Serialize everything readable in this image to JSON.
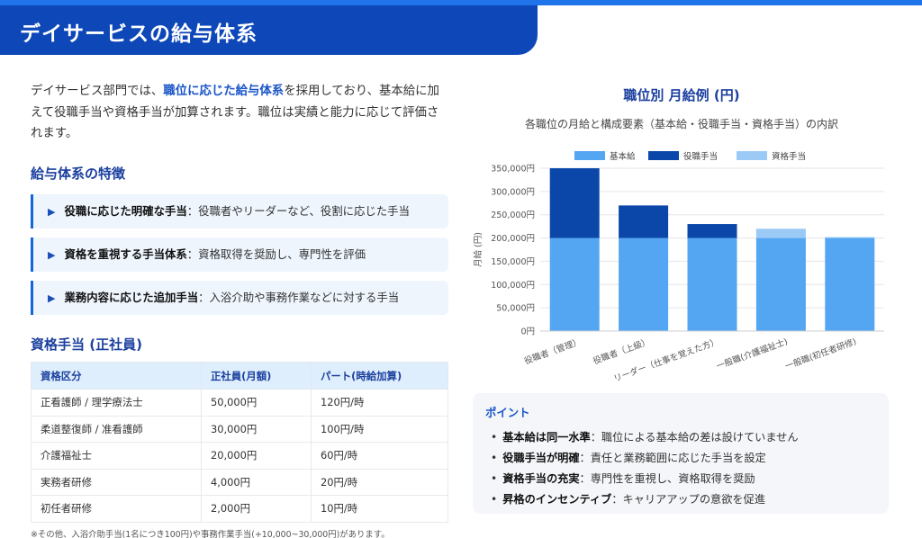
{
  "header": {
    "title": "デイサービスの給与体系"
  },
  "intro": {
    "pre": "デイサービス部門では、",
    "highlight": "職位に応じた給与体系",
    "post": "を採用しており、基本給に加えて役職手当や資格手当が加算されます。職位は実績と能力に応じて評価されます。"
  },
  "features": {
    "title": "給与体系の特徴",
    "items": [
      {
        "bold": "役職に応じた明確な手当",
        "text": "：役職者やリーダーなど、役割に応じた手当"
      },
      {
        "bold": "資格を重視する手当体系",
        "text": "：資格取得を奨励し、専門性を評価"
      },
      {
        "bold": "業務内容に応じた追加手当",
        "text": "：入浴介助や事務作業などに対する手当"
      }
    ]
  },
  "qualification": {
    "title": "資格手当 (正社員)",
    "headers": [
      "資格区分",
      "正社員(月額)",
      "パート(時給加算)"
    ],
    "rows": [
      [
        "正看護師 / 理学療法士",
        "50,000円",
        "120円/時"
      ],
      [
        "柔道整復師 / 准看護師",
        "30,000円",
        "100円/時"
      ],
      [
        "介護福祉士",
        "20,000円",
        "60円/時"
      ],
      [
        "実務者研修",
        "4,000円",
        "20円/時"
      ],
      [
        "初任者研修",
        "2,000円",
        "10円/時"
      ]
    ],
    "footnote": "※その他、入浴介助手当(1名につき100円)や事務作業手当(+10,000~30,000円)があります。"
  },
  "chart_data": {
    "type": "bar",
    "stacked": true,
    "title": "職位別 月給例 (円)",
    "subtitle": "各職位の月給と構成要素（基本給・役職手当・資格手当）の内訳",
    "ylabel": "月給 (円)",
    "xlabel": "",
    "ylim": [
      0,
      350000
    ],
    "yticks": [
      0,
      50000,
      100000,
      150000,
      200000,
      250000,
      300000,
      350000
    ],
    "ytick_labels": [
      "0円",
      "50,000円",
      "100,000円",
      "150,000円",
      "200,000円",
      "250,000円",
      "300,000円",
      "350,000円"
    ],
    "grid": true,
    "legend": "top",
    "categories": [
      "役職者（管理）",
      "役職者（上級）",
      "リーダー（仕事を覚えた方）",
      "一般職(介護福祉士)",
      "一般職(初任者研修)"
    ],
    "series": [
      {
        "name": "基本給",
        "color": "#54a5f2",
        "values": [
          200000,
          200000,
          200000,
          200000,
          200000
        ]
      },
      {
        "name": "役職手当",
        "color": "#0a47a9",
        "values": [
          150000,
          70000,
          30000,
          0,
          0
        ]
      },
      {
        "name": "資格手当",
        "color": "#9ccaf7",
        "values": [
          0,
          0,
          0,
          20000,
          2000
        ]
      }
    ]
  },
  "points": {
    "title": "ポイント",
    "items": [
      {
        "bold": "基本給は同一水準",
        "text": "：職位による基本給の差は設けていません"
      },
      {
        "bold": "役職手当が明確",
        "text": "：責任と業務範囲に応じた手当を設定"
      },
      {
        "bold": "資格手当の充実",
        "text": "：専門性を重視し、資格取得を奨励"
      },
      {
        "bold": "昇格のインセンティブ",
        "text": "：キャリアアップの意欲を促進"
      }
    ]
  }
}
